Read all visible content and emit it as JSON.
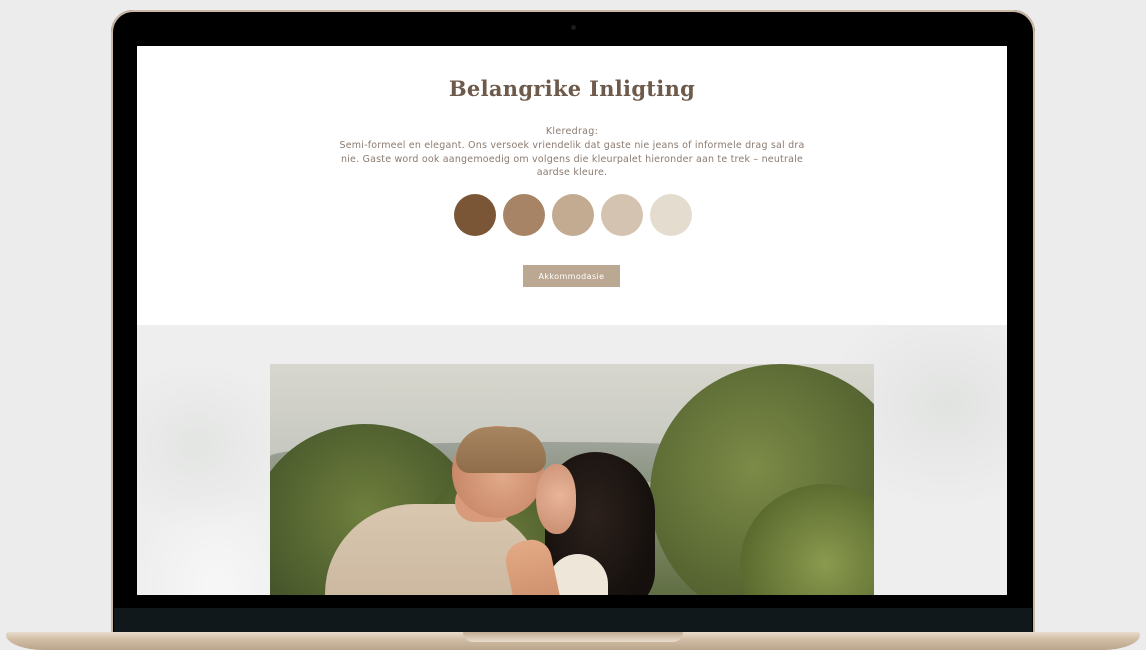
{
  "info": {
    "title": "Belangrike Inligting",
    "dress_label": "Kleredrag:",
    "dress_text": "Semi-formeel en elegant. Ons versoek vriendelik dat gaste nie jeans of informele drag sal dra nie. Gaste word ook aangemoedig om volgens die kleurpalet hieronder aan te trek – neutrale aardse kleure.",
    "palette": [
      "#7a5637",
      "#a88466",
      "#c2ab91",
      "#d4c3b0",
      "#e4dccf"
    ],
    "button_label": "Akkommodasie"
  },
  "colors": {
    "title": "#6e5a4b",
    "body_text": "#8b7b70",
    "button_bg": "#bba892",
    "photo_section_bg": "#eeeeee"
  }
}
